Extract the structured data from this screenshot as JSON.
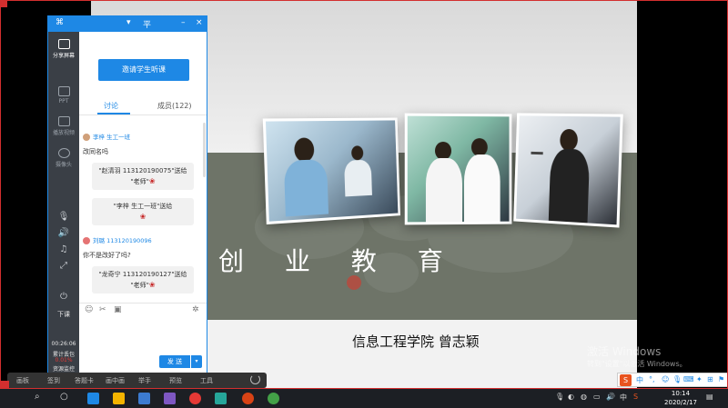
{
  "slide": {
    "title": "创 业 教 育",
    "presenter": "信息工程学院 曾志颖"
  },
  "panel": {
    "titlebar": {
      "pin": "▾",
      "share": "平",
      "minimize": "–",
      "close": "×"
    },
    "sidebar": [
      {
        "label": "分享屏幕",
        "icon": "share-screen-icon"
      },
      {
        "label": "PPT",
        "icon": "ppt-icon"
      },
      {
        "label": "播放视频",
        "icon": "play-video-icon"
      },
      {
        "label": "摄像头",
        "icon": "camera-icon"
      }
    ],
    "sidebar_bottom": {
      "end_label": "下课",
      "timer": "00:26:06",
      "stat_label": "累计丢包",
      "stat_value": "0.01%",
      "monitor_label": "资源监控"
    },
    "invite_label": "邀请学生听课",
    "tabs": {
      "discuss": "讨论",
      "members": "成员(122)"
    },
    "messages": [
      {
        "type": "user",
        "name": "李梓 生工一班",
        "text": "改同名吗"
      },
      {
        "type": "gift",
        "line1": "\"赵清羽 113120190075\"送给",
        "line2": "\"老师\""
      },
      {
        "type": "gift",
        "line1": "\"李梓 生工一班\"送给",
        "line2": ""
      },
      {
        "type": "user",
        "name": "刘璐 113120190096",
        "text": "你不是改好了吗?"
      },
      {
        "type": "gift",
        "line1": "\"龙奇宁 113120190127\"送给",
        "line2": "\"老师\""
      }
    ],
    "send_label": "发 送"
  },
  "tooltrip": {
    "items": [
      "画板",
      "签到",
      "答题卡",
      "画中画",
      "举手",
      "预览",
      "工具"
    ]
  },
  "watermark": {
    "line1": "激活 Windows",
    "line2": "转到\"设置\"以激活 Windows。"
  },
  "ime": {
    "logo": "S",
    "lang": "中"
  },
  "taskbar": {
    "time": "10:14",
    "date": "2020/2/17",
    "lang": "中",
    "apps": [
      {
        "name": "edge",
        "color": "#1e88e5"
      },
      {
        "name": "explorer",
        "color": "#f4b400"
      },
      {
        "name": "store",
        "color": "#3c7bd0"
      },
      {
        "name": "paint",
        "color": "#7e57c2"
      },
      {
        "name": "chrome",
        "color": "#e53935"
      },
      {
        "name": "app",
        "color": "#26a69a"
      },
      {
        "name": "powerpoint",
        "color": "#d84315"
      },
      {
        "name": "wechat",
        "color": "#43a047"
      }
    ]
  }
}
